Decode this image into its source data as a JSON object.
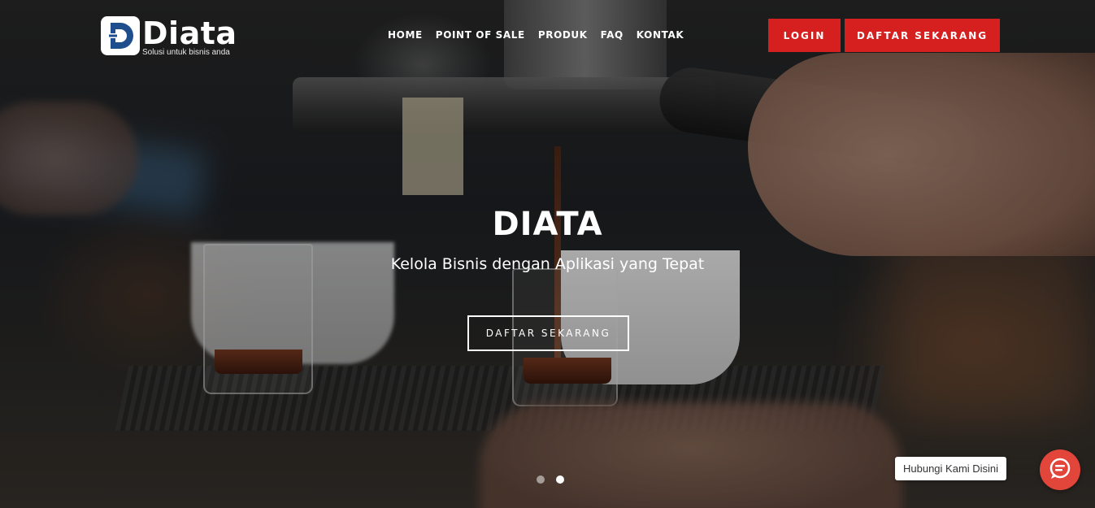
{
  "brand": {
    "name": "Diata",
    "tagline": "Solusi untuk bisnis anda",
    "logo_color": "#1f4e8c"
  },
  "nav": {
    "items": [
      {
        "label": "HOME"
      },
      {
        "label": "POINT OF SALE"
      },
      {
        "label": "PRODUK"
      },
      {
        "label": "FAQ"
      },
      {
        "label": "KONTAK"
      }
    ]
  },
  "header_buttons": {
    "login_label": "LOGIN",
    "register_label": "DAFTAR SEKARANG",
    "accent_color": "#d61f1f"
  },
  "hero": {
    "title": "DIATA",
    "subtitle": "Kelola Bisnis dengan Aplikasi yang Tepat",
    "cta_label": "DAFTAR SEKARANG",
    "slide_count": 2,
    "active_slide": 2
  },
  "chat": {
    "label": "Hubungi Kami Disini",
    "icon": "chat-bubbles-icon",
    "color": "#e2463a"
  }
}
